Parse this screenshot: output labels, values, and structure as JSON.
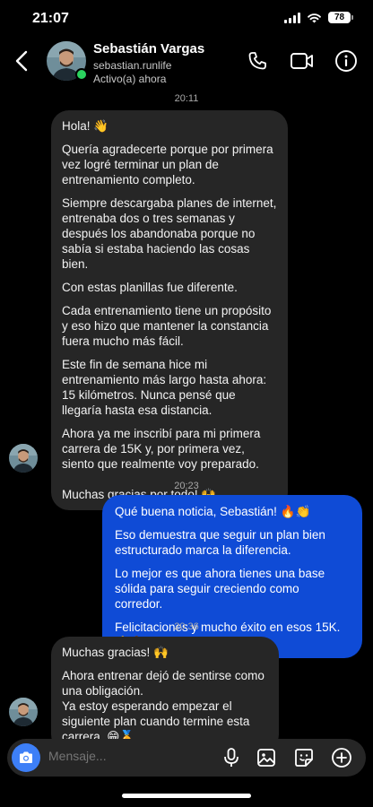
{
  "status_bar": {
    "time": "21:07",
    "battery": "78"
  },
  "header": {
    "name": "Sebastián Vargas",
    "handle": "sebastian.runlife",
    "status": "Activo(a) ahora"
  },
  "conversation": [
    {
      "type": "timestamp",
      "text": "20:11"
    },
    {
      "type": "incoming",
      "paragraphs": [
        "Hola! 👋",
        "Quería agradecerte porque por primera vez logré terminar un plan de entrenamiento completo.",
        "Siempre descargaba planes de internet, entrenaba dos o tres semanas y después los abandonaba porque no sabía si estaba haciendo las cosas bien.",
        "Con estas planillas fue diferente.",
        "Cada entrenamiento tiene un propósito y eso hizo que mantener la constancia fuera mucho más fácil.",
        "Este fin de semana hice mi entrenamiento más largo hasta ahora: 15 kilómetros. Nunca pensé que llegaría hasta esa distancia.",
        "Ahora ya me inscribí para mi primera carrera de 15K y, por primera vez, siento que realmente voy preparado.",
        "Muchas gracias por todo! 🙌"
      ]
    },
    {
      "type": "timestamp",
      "text": "20:23"
    },
    {
      "type": "outgoing",
      "paragraphs": [
        "Qué buena noticia, Sebastián! 🔥👏",
        "Eso demuestra que seguir un plan bien estructurado marca la diferencia.",
        "Lo mejor es que ahora tienes una base sólida para seguir creciendo como corredor.",
        "Felicitaciones y mucho éxito en esos 15K. 💪🏃"
      ]
    },
    {
      "type": "timestamp",
      "text": "20:36"
    },
    {
      "type": "incoming",
      "paragraphs": [
        "Muchas gracias! 🙌",
        "Ahora entrenar dejó de sentirse como una obligación.\nYa estoy esperando empezar el siguiente plan cuando termine esta carrera. 😁🏅"
      ]
    }
  ],
  "composer": {
    "placeholder": "Mensaje..."
  },
  "colors": {
    "outgoing_bubble": "#0f4bd6",
    "incoming_bubble": "#262626",
    "online": "#2bd25f",
    "camera": "#3d7ff7"
  }
}
